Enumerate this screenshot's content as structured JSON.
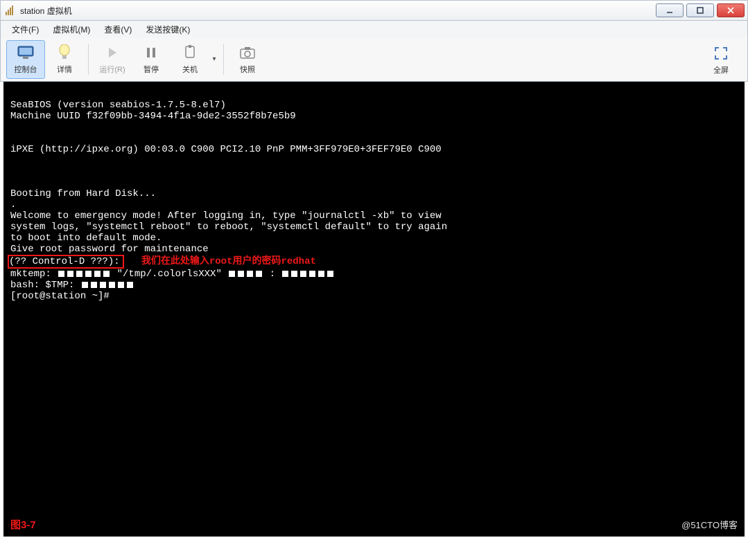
{
  "titlebar": {
    "title": "station 虚拟机"
  },
  "menu": {
    "file": "文件(F)",
    "vm": "虚拟机(M)",
    "view": "查看(V)",
    "sendkey": "发送按键(K)"
  },
  "toolbar": {
    "console": "控制台",
    "details": "详情",
    "run": "运行(R)",
    "pause": "暂停",
    "shutdown": "关机",
    "snapshot": "快照",
    "fullscreen": "全屏"
  },
  "console": {
    "l1": "SeaBIOS (version seabios-1.7.5-8.el7)",
    "l2": "Machine UUID f32f09bb-3494-4f1a-9de2-3552f8b7e5b9",
    "l3": "iPXE (http://ipxe.org) 00:03.0 C900 PCI2.10 PnP PMM+3FF979E0+3FEF79E0 C900",
    "l4": "Booting from Hard Disk...",
    "l5": ".",
    "l6": "Welcome to emergency mode! After logging in, type \"journalctl -xb\" to view",
    "l7": "system logs, \"systemctl reboot\" to reboot, \"systemctl default\" to try again",
    "l8": "to boot into default mode.",
    "l9": "Give root password for maintenance",
    "l10": "(?? Control-D ???):",
    "ann": "我们在此处输入root用户的密码redhat",
    "l11a": "mktemp: ",
    "l11b": " \"/tmp/.colorlsXXX\" ",
    "l11c": " : ",
    "l12": "bash: $TMP: ",
    "l13": "[root@station ~]#",
    "fig": "图3-7",
    "watermark": "@51CTO博客"
  }
}
